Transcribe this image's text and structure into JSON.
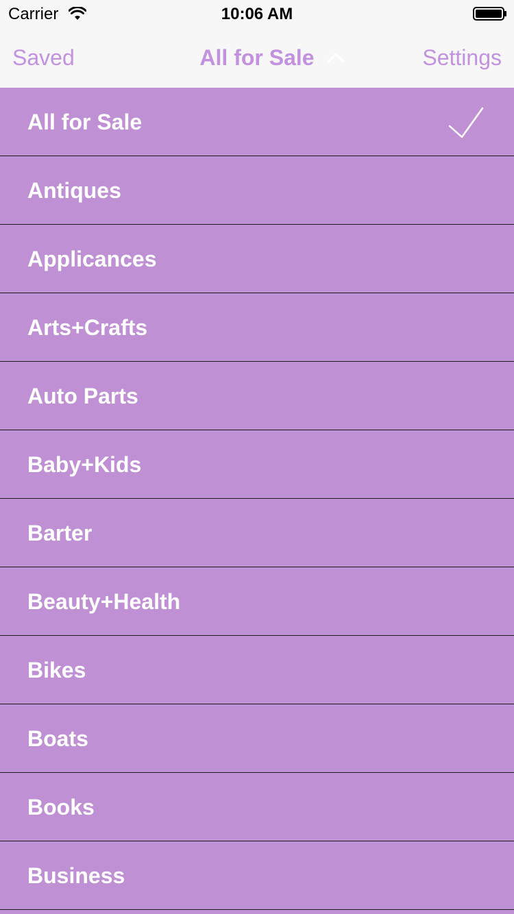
{
  "status": {
    "carrier": "Carrier",
    "time": "10:06 AM"
  },
  "nav": {
    "left_label": "Saved",
    "title": "All for Sale",
    "right_label": "Settings"
  },
  "categories": [
    {
      "label": "All for Sale",
      "selected": true
    },
    {
      "label": "Antiques",
      "selected": false
    },
    {
      "label": "Applicances",
      "selected": false
    },
    {
      "label": "Arts+Crafts",
      "selected": false
    },
    {
      "label": "Auto Parts",
      "selected": false
    },
    {
      "label": "Baby+Kids",
      "selected": false
    },
    {
      "label": "Barter",
      "selected": false
    },
    {
      "label": "Beauty+Health",
      "selected": false
    },
    {
      "label": "Bikes",
      "selected": false
    },
    {
      "label": "Boats",
      "selected": false
    },
    {
      "label": "Books",
      "selected": false
    },
    {
      "label": "Business",
      "selected": false
    }
  ],
  "colors": {
    "accent": "#c291e0",
    "list_background": "#bf91d4",
    "row_text": "#ffffff",
    "separator": "#1a1a1a"
  },
  "icons": {
    "wifi": "wifi-icon",
    "battery": "battery-icon",
    "title_chevron": "chevron-up-icon",
    "selected_marker": "checkmark-icon"
  }
}
